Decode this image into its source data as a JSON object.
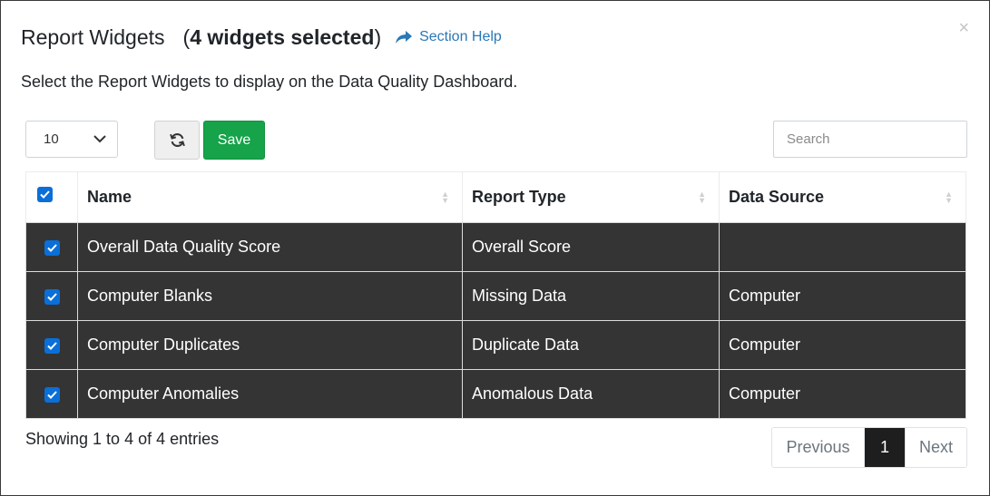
{
  "header": {
    "title": "Report Widgets",
    "selected_prefix": "(",
    "selected_bold": "4 widgets selected",
    "selected_suffix": ")",
    "help_label": "Section Help",
    "close_glyph": "×"
  },
  "intro": "Select the Report Widgets to display on the Data Quality Dashboard.",
  "toolbar": {
    "page_size": "10",
    "save_label": "Save",
    "search_placeholder": "Search"
  },
  "table": {
    "columns": [
      "Name",
      "Report Type",
      "Data Source"
    ],
    "rows": [
      {
        "name": "Overall Data Quality Score",
        "type": "Overall Score",
        "source": "",
        "checked": true
      },
      {
        "name": "Computer Blanks",
        "type": "Missing Data",
        "source": "Computer",
        "checked": true
      },
      {
        "name": "Computer Duplicates",
        "type": "Duplicate Data",
        "source": "Computer",
        "checked": true
      },
      {
        "name": "Computer Anomalies",
        "type": "Anomalous Data",
        "source": "Computer",
        "checked": true
      }
    ]
  },
  "footer": {
    "info": "Showing 1 to 4 of 4 entries",
    "previous": "Previous",
    "current_page": "1",
    "next": "Next"
  },
  "colors": {
    "accent": "#2a78b6",
    "save": "#16a34a",
    "row_bg": "#343434",
    "checkbox": "#0a6fd8"
  },
  "icons": [
    "share-arrow-icon",
    "close-icon",
    "chevron-down-icon",
    "refresh-icon",
    "sort-icon",
    "checkmark-icon"
  ]
}
